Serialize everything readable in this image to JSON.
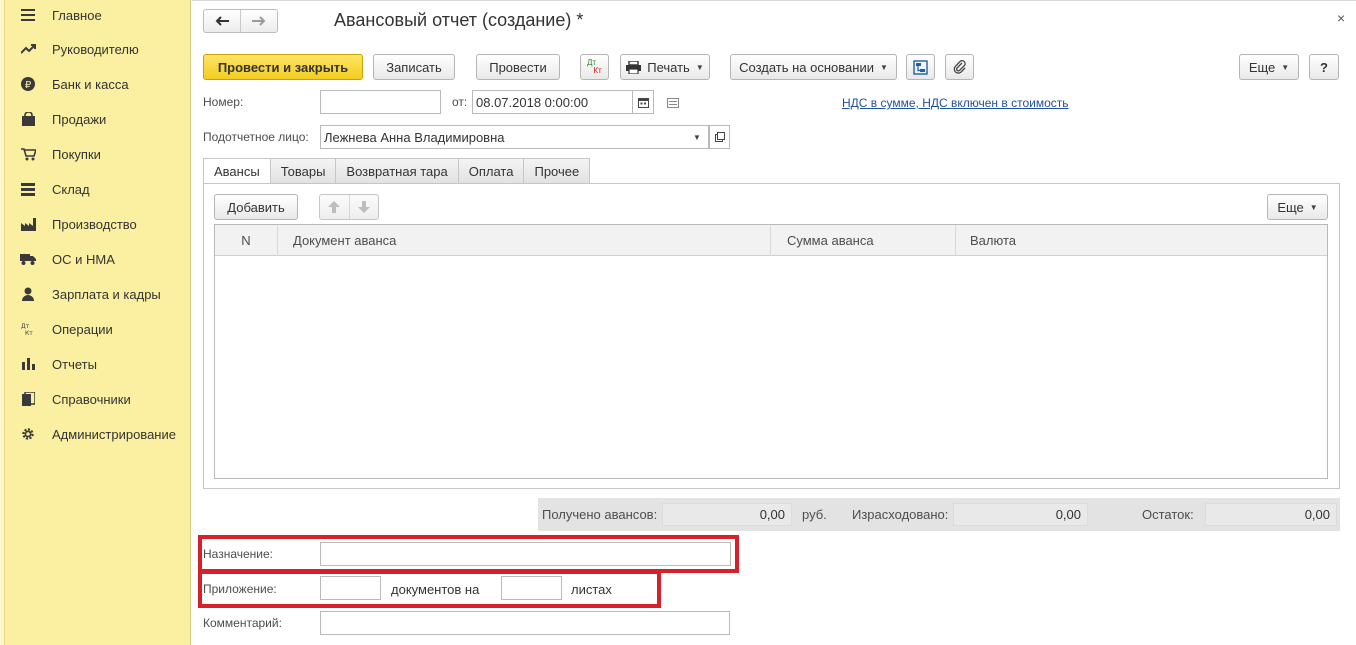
{
  "sidebar": {
    "items": [
      {
        "label": "Главное",
        "icon": "menu-icon"
      },
      {
        "label": "Руководителю",
        "icon": "trend-icon"
      },
      {
        "label": "Банк и касса",
        "icon": "ruble-icon"
      },
      {
        "label": "Продажи",
        "icon": "bag-icon"
      },
      {
        "label": "Покупки",
        "icon": "cart-icon"
      },
      {
        "label": "Склад",
        "icon": "warehouse-icon"
      },
      {
        "label": "Производство",
        "icon": "factory-icon"
      },
      {
        "label": "ОС и НМА",
        "icon": "truck-icon"
      },
      {
        "label": "Зарплата и кадры",
        "icon": "person-icon"
      },
      {
        "label": "Операции",
        "icon": "dt-kt-icon"
      },
      {
        "label": "Отчеты",
        "icon": "bar-chart-icon"
      },
      {
        "label": "Справочники",
        "icon": "books-icon"
      },
      {
        "label": "Администрирование",
        "icon": "gear-icon"
      }
    ]
  },
  "header": {
    "title": "Авансовый отчет (создание) *",
    "close": "×"
  },
  "toolbar": {
    "post_close": "Провести и закрыть",
    "save": "Записать",
    "post": "Провести",
    "dtkt_top": "Дт",
    "dtkt_bottom": "Кт",
    "print": "Печать",
    "create_based": "Создать на основании",
    "more": "Еще",
    "help": "?"
  },
  "form": {
    "number_label": "Номер:",
    "number_value": "",
    "date_label": "от:",
    "date_value": "08.07.2018  0:00:00",
    "vat_link": "НДС в сумме, НДС включен в стоимость",
    "person_label": "Подотчетное лицо:",
    "person_value": "Лежнева Анна Владимировна"
  },
  "tabs": [
    "Авансы",
    "Товары",
    "Возвратная тара",
    "Оплата",
    "Прочее"
  ],
  "table": {
    "add_button": "Добавить",
    "more": "Еще",
    "columns": [
      "N",
      "Документ аванса",
      "Сумма аванса",
      "Валюта"
    ],
    "rows": []
  },
  "totals": {
    "received_label": "Получено авансов:",
    "received_value": "0,00",
    "currency": "руб.",
    "spent_label": "Израсходовано:",
    "spent_value": "0,00",
    "balance_label": "Остаток:",
    "balance_value": "0,00"
  },
  "footer": {
    "purpose_label": "Назначение:",
    "purpose_value": "",
    "attachment_label": "Приложение:",
    "attachment_docs": "",
    "docs_on": "документов на",
    "attachment_sheets": "",
    "sheets": "листах",
    "comment_label": "Комментарий:",
    "comment_value": ""
  },
  "colors": {
    "sidebar_bg": "#fbf0a1",
    "primary_button": "#f2cd1e",
    "highlight": "#d6202a",
    "link": "#1f4f9e"
  }
}
